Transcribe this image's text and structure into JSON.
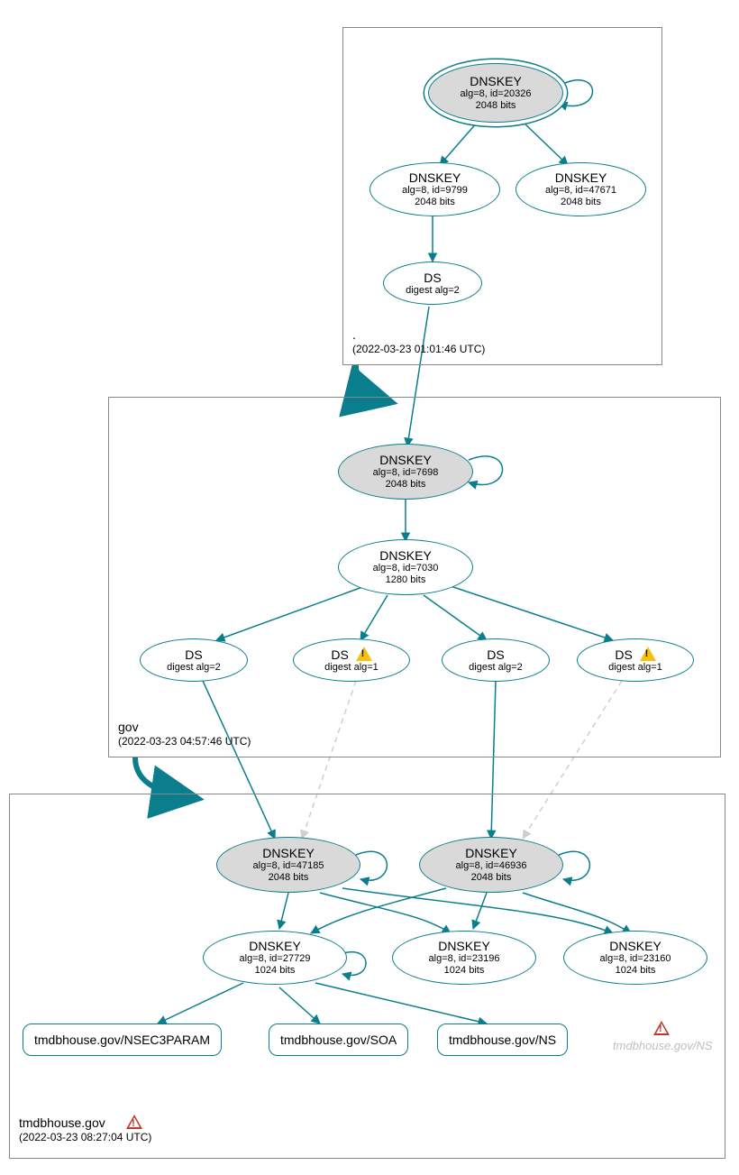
{
  "zones": {
    "root": {
      "name": ".",
      "timestamp": "(2022-03-23 01:01:46 UTC)"
    },
    "gov": {
      "name": "gov",
      "timestamp": "(2022-03-23 04:57:46 UTC)"
    },
    "leaf": {
      "name": "tmdbhouse.gov",
      "timestamp": "(2022-03-23 08:27:04 UTC)"
    }
  },
  "nodes": {
    "root_ksk": {
      "title": "DNSKEY",
      "sub1": "alg=8, id=20326",
      "sub2": "2048 bits"
    },
    "root_zsk1": {
      "title": "DNSKEY",
      "sub1": "alg=8, id=9799",
      "sub2": "2048 bits"
    },
    "root_zsk2": {
      "title": "DNSKEY",
      "sub1": "alg=8, id=47671",
      "sub2": "2048 bits"
    },
    "root_ds": {
      "title": "DS",
      "sub1": "digest alg=2"
    },
    "gov_ksk": {
      "title": "DNSKEY",
      "sub1": "alg=8, id=7698",
      "sub2": "2048 bits"
    },
    "gov_zsk": {
      "title": "DNSKEY",
      "sub1": "alg=8, id=7030",
      "sub2": "1280 bits"
    },
    "gov_ds1": {
      "title": "DS",
      "sub1": "digest alg=2"
    },
    "gov_ds2": {
      "title": "DS",
      "sub1": "digest alg=1"
    },
    "gov_ds3": {
      "title": "DS",
      "sub1": "digest alg=2"
    },
    "gov_ds4": {
      "title": "DS",
      "sub1": "digest alg=1"
    },
    "leaf_ksk1": {
      "title": "DNSKEY",
      "sub1": "alg=8, id=47185",
      "sub2": "2048 bits"
    },
    "leaf_ksk2": {
      "title": "DNSKEY",
      "sub1": "alg=8, id=46936",
      "sub2": "2048 bits"
    },
    "leaf_zsk1": {
      "title": "DNSKEY",
      "sub1": "alg=8, id=27729",
      "sub2": "1024 bits"
    },
    "leaf_zsk2": {
      "title": "DNSKEY",
      "sub1": "alg=8, id=23196",
      "sub2": "1024 bits"
    },
    "leaf_zsk3": {
      "title": "DNSKEY",
      "sub1": "alg=8, id=23160",
      "sub2": "1024 bits"
    }
  },
  "rr": {
    "nsec3": "tmdbhouse.gov/NSEC3PARAM",
    "soa": "tmdbhouse.gov/SOA",
    "ns": "tmdbhouse.gov/NS"
  },
  "ghost_ns": "tmdbhouse.gov/NS",
  "colors": {
    "stroke": "#0a7e8c",
    "dashed": "#cfcfcf"
  }
}
